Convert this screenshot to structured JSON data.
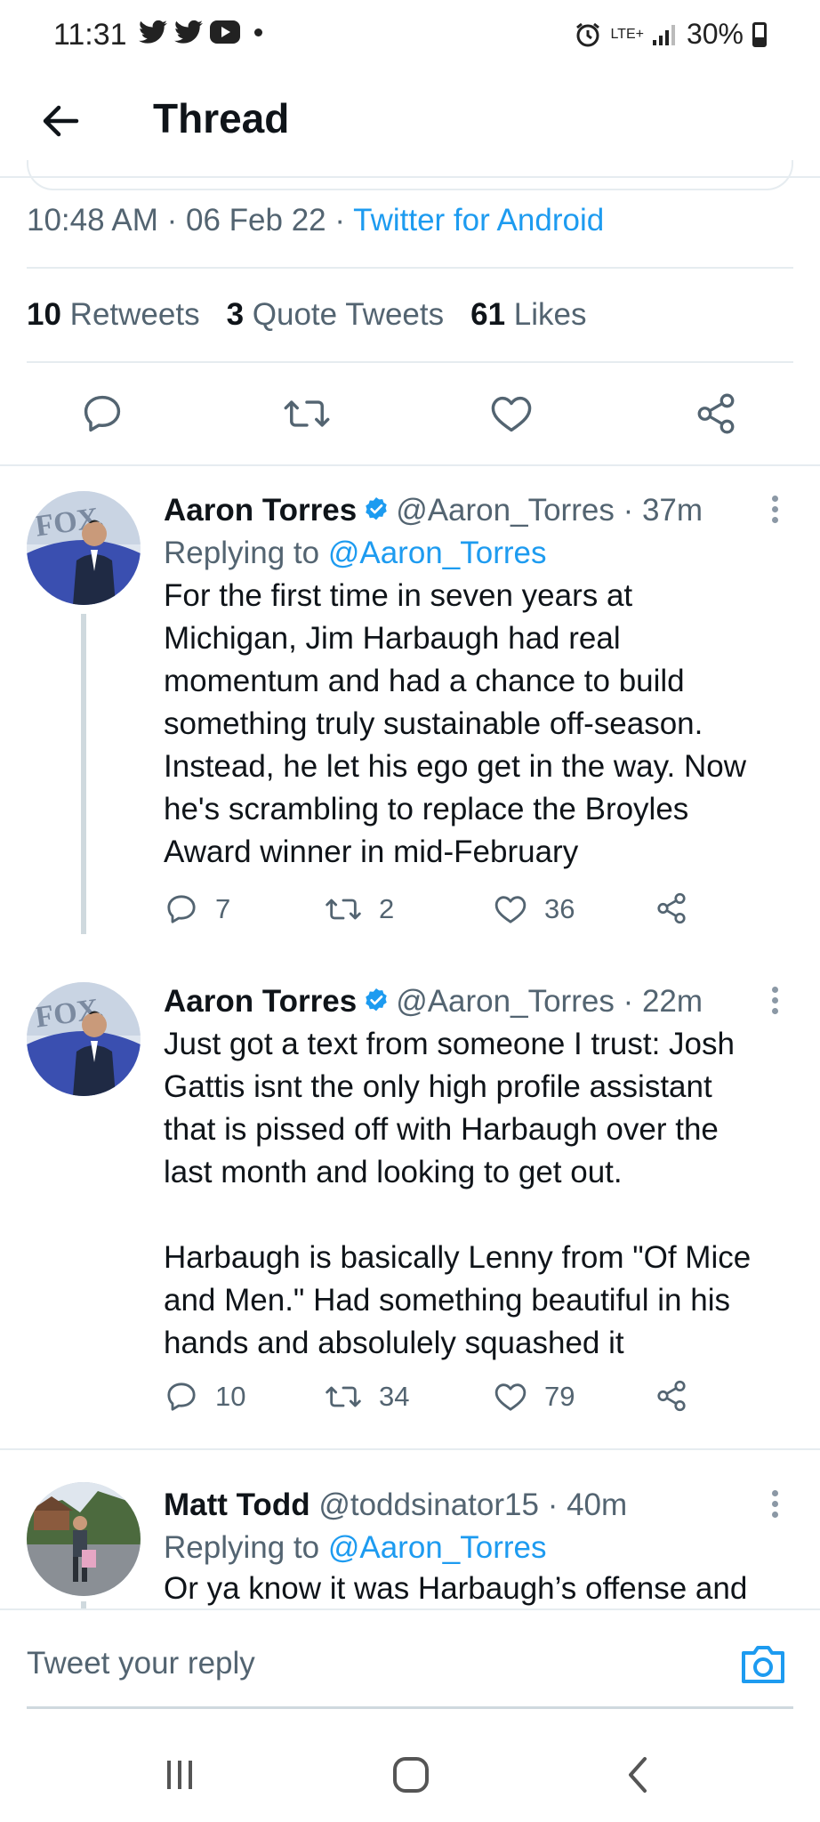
{
  "status_bar": {
    "time": "11:31",
    "network": "LTE+",
    "battery": "30%",
    "left_icons": [
      "twitter-icon",
      "twitter-icon",
      "youtube-icon",
      "dot-icon"
    ]
  },
  "header": {
    "title": "Thread"
  },
  "tweet_meta": {
    "time": "10:48 AM",
    "date": "06 Feb 22",
    "source": "Twitter for Android"
  },
  "stats": {
    "retweets_count": "10",
    "retweets_label": "Retweets",
    "quotes_count": "3",
    "quotes_label": "Quote Tweets",
    "likes_count": "61",
    "likes_label": "Likes"
  },
  "tweets": [
    {
      "name": "Aaron Torres",
      "handle": "@Aaron_Torres",
      "time": "· 37m",
      "replying_label": "Replying to",
      "replying_to": "@Aaron_Torres",
      "body": "For the first time in seven years at\nMichigan, Jim Harbaugh had real\nmomentum and had a chance to build\nsomething truly sustainable off-season.\nInstead, he let his ego get in the way. Now\nhe's scrambling to replace the Broyles\nAward winner in mid-February",
      "replies": "7",
      "retweets": "2",
      "likes": "36"
    },
    {
      "name": "Aaron Torres",
      "handle": "@Aaron_Torres",
      "time": "· 22m",
      "body": "Just got a text from someone I trust: Josh\nGattis isnt the only high profile assistant\nthat is pissed off with Harbaugh over the\nlast month and looking to get out.\n\nHarbaugh is basically Lenny from \"Of Mice\nand Men.\" Had something beautiful in his\nhands and absolulely squashed it",
      "replies": "10",
      "retweets": "34",
      "likes": "79"
    },
    {
      "name": "Matt Todd",
      "handle": "@toddsinator15",
      "time": "· 40m",
      "replying_label": "Replying to",
      "replying_to": "@Aaron_Torres",
      "body": "Or ya know it was Harbaugh’s offense and"
    }
  ],
  "composer": {
    "placeholder": "Tweet your reply"
  },
  "colors": {
    "accent": "#1d9bf0",
    "secondary_text": "#536471",
    "divider": "#e6ecf0"
  }
}
